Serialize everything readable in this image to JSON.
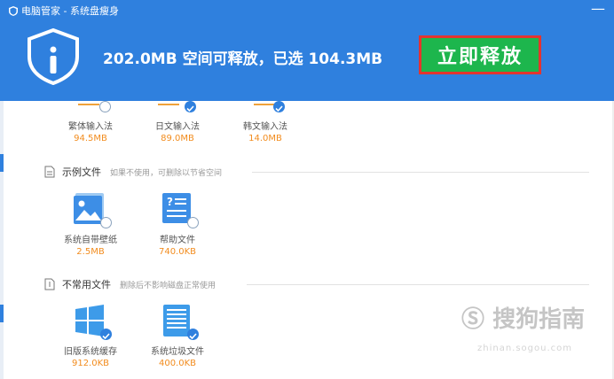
{
  "window": {
    "title": "电脑管家 - 系统盘瘦身",
    "close": "—"
  },
  "header": {
    "summary": "202.0MB 空间可释放，已选 104.3MB",
    "release_button": "立即释放"
  },
  "top_row": [
    {
      "label": "繁体输入法",
      "size": "94.5MB",
      "checked": false
    },
    {
      "label": "日文输入法",
      "size": "89.0MB",
      "checked": true
    },
    {
      "label": "韩文输入法",
      "size": "14.0MB",
      "checked": true
    }
  ],
  "sections": [
    {
      "title": "示例文件",
      "desc": "如果不使用，可删除以节省空间",
      "items": [
        {
          "label": "系统自带壁纸",
          "size": "2.5MB",
          "checked": false,
          "icon": "wallpaper-icon"
        },
        {
          "label": "帮助文件",
          "size": "740.0KB",
          "checked": false,
          "icon": "help-file-icon"
        }
      ]
    },
    {
      "title": "不常用文件",
      "desc": "删除后不影响磁盘正常使用",
      "items": [
        {
          "label": "旧版系统缓存",
          "size": "912.0KB",
          "checked": true,
          "icon": "windows-icon"
        },
        {
          "label": "系统垃圾文件",
          "size": "400.0KB",
          "checked": true,
          "icon": "trash-file-icon"
        }
      ]
    }
  ],
  "watermark": {
    "text": "搜狗指南",
    "url": "zhinan.sogou.com"
  },
  "colors": {
    "header": "#2f80de",
    "button": "#1db64d",
    "button_border": "#e3342f",
    "size_text": "#f28c1e"
  }
}
